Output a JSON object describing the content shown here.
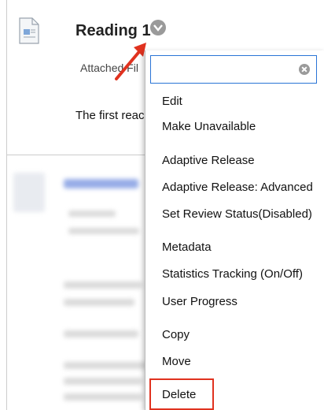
{
  "content_item": {
    "title": "Reading 1",
    "attached_label": "Attached Fil",
    "description": "The first reac"
  },
  "menu": {
    "search": {
      "value": "",
      "placeholder": ""
    },
    "items": [
      {
        "label": "Edit"
      },
      {
        "label": "Make Unavailable"
      },
      {
        "label": "Adaptive Release"
      },
      {
        "label": "Adaptive Release: Advanced"
      },
      {
        "label": "Set Review Status(Disabled)"
      },
      {
        "label": "Metadata"
      },
      {
        "label": "Statistics Tracking (On/Off)"
      },
      {
        "label": "User Progress"
      },
      {
        "label": "Copy"
      },
      {
        "label": "Move"
      },
      {
        "label": "Delete"
      }
    ]
  },
  "colors": {
    "annotation_red": "#e0321f",
    "search_focus_blue": "#2a74d6",
    "chevron_gray": "#9a9a9a"
  },
  "icons": {
    "item_icon": "document-icon",
    "options": "chevron-down-icon",
    "clear": "clear-icon"
  }
}
